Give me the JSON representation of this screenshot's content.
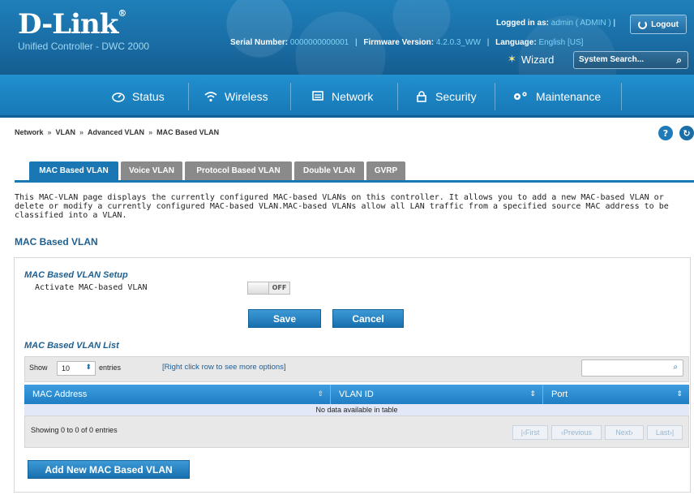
{
  "header": {
    "logo": "D-Link",
    "logo_mark": "®",
    "subtitle": "Unified Controller - DWC 2000",
    "serial_label": "Serial Number:",
    "serial_value": "0000000000001",
    "firmware_label": "Firmware Version:",
    "firmware_value": "4.2.0.3_WW",
    "language_label": "Language:",
    "language_value": "English [US]",
    "separator": "|",
    "logged_label": "Logged in as:",
    "logged_value": "admin ( ADMIN )",
    "separator2": "|",
    "logout_label": "Logout",
    "wizard_label": "Wizard",
    "search_placeholder": "System Search..."
  },
  "nav": {
    "items": [
      {
        "label": "Status",
        "icon": "status-icon"
      },
      {
        "label": "Wireless",
        "icon": "wireless-icon"
      },
      {
        "label": "Network",
        "icon": "network-icon"
      },
      {
        "label": "Security",
        "icon": "lock-icon"
      },
      {
        "label": "Maintenance",
        "icon": "gears-icon"
      }
    ]
  },
  "breadcrumb": {
    "items": [
      "Network",
      "VLAN",
      "Advanced VLAN",
      "MAC Based VLAN"
    ],
    "sep": "»"
  },
  "tabs": [
    {
      "label": "MAC Based VLAN",
      "active": true
    },
    {
      "label": "Voice VLAN",
      "active": false
    },
    {
      "label": "Protocol Based VLAN",
      "active": false
    },
    {
      "label": "Double VLAN",
      "active": false
    },
    {
      "label": "GVRP",
      "active": false
    }
  ],
  "description": "This MAC-VLAN page displays the currently configured MAC-based VLANs on this controller. It allows you to add a new MAC-based VLAN or delete or modify a currently configured MAC-based VLAN.MAC-based VLANs allow all LAN traffic from a specified source MAC address to be classified into a VLAN.",
  "page_heading": "MAC Based VLAN",
  "setup": {
    "title": "MAC Based VLAN Setup",
    "activate_label": "Activate MAC-based VLAN",
    "toggle_state": "OFF",
    "save_label": "Save",
    "cancel_label": "Cancel"
  },
  "list": {
    "title": "MAC Based VLAN List",
    "show_label": "Show",
    "entries_value": "10",
    "entries_label": "entries",
    "hint": "[Right click row to see more options]",
    "columns": [
      "MAC Address",
      "VLAN ID",
      "Port"
    ],
    "empty_text": "No data available in table",
    "showing_text": "Showing 0 to 0 of 0 entries",
    "pagination": [
      "First",
      "Previous",
      "Next",
      "Last"
    ]
  },
  "add_button_label": "Add New MAC Based VLAN",
  "colors": {
    "header_blue": "#1a6ea6",
    "accent": "#1a77b3",
    "tab_inactive": "#8a8a8a"
  }
}
